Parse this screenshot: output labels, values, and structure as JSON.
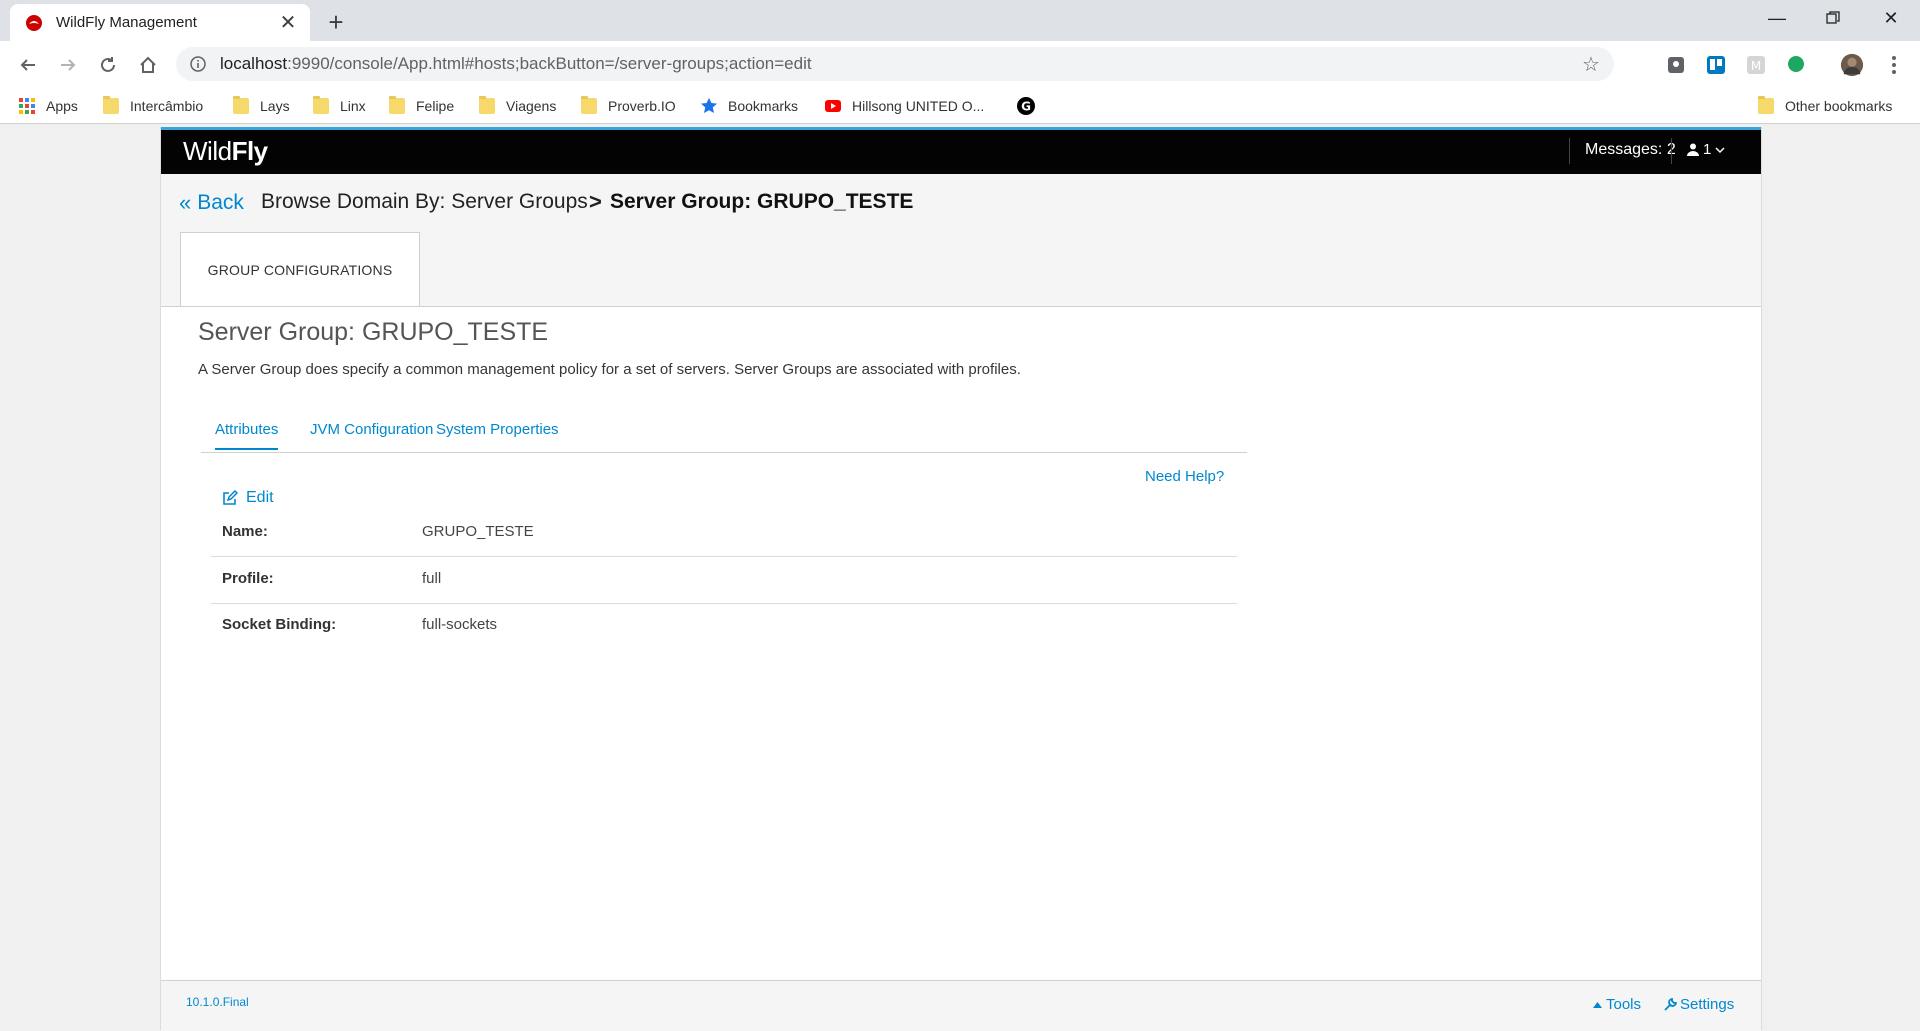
{
  "browser": {
    "tab_title": "WildFly Management",
    "url_host": "localhost",
    "url_rest": ":9990/console/App.html#hosts;backButton=/server-groups;action=edit",
    "bookmarks": [
      {
        "label": "Apps",
        "icon": "apps-grid-icon"
      },
      {
        "label": "Intercâmbio",
        "icon": "folder-icon"
      },
      {
        "label": "Lays",
        "icon": "folder-icon"
      },
      {
        "label": "Linx",
        "icon": "folder-icon"
      },
      {
        "label": "Felipe",
        "icon": "folder-icon"
      },
      {
        "label": "Viagens",
        "icon": "folder-icon"
      },
      {
        "label": "Proverb.IO",
        "icon": "folder-icon"
      },
      {
        "label": "Bookmarks",
        "icon": "star-icon"
      },
      {
        "label": "Hillsong UNITED O...",
        "icon": "youtube-icon"
      },
      {
        "label": "Other bookmarks",
        "icon": "folder-icon"
      }
    ],
    "g_badge": "G"
  },
  "app": {
    "brand_light": "Wild",
    "brand_bold": "Fly",
    "messages": "Messages: 2",
    "user_count": "1"
  },
  "header": {
    "back": "Back",
    "breadcrumb": "Browse Domain By: Server Groups",
    "separator": ">",
    "current": "Server Group: GRUPO_TESTE",
    "tab": "GROUP CONFIGURATIONS"
  },
  "content": {
    "title": "Server Group: GRUPO_TESTE",
    "description": "A Server Group does specify a common management policy for a set of servers. Server Groups are associated with profiles.",
    "tabs": [
      "Attributes",
      "JVM Configuration",
      "System Properties"
    ],
    "need_help": "Need Help?",
    "edit": "Edit",
    "attributes": [
      {
        "label": "Name:",
        "value": "GRUPO_TESTE"
      },
      {
        "label": "Profile:",
        "value": "full"
      },
      {
        "label": "Socket Binding:",
        "value": "full-sockets"
      }
    ]
  },
  "footer": {
    "version": "10.1.0.Final",
    "tools": "Tools",
    "settings": "Settings"
  },
  "colors": {
    "link": "#0088ce",
    "topbar": "#030303",
    "accent_stripe": "#39a5dc"
  }
}
